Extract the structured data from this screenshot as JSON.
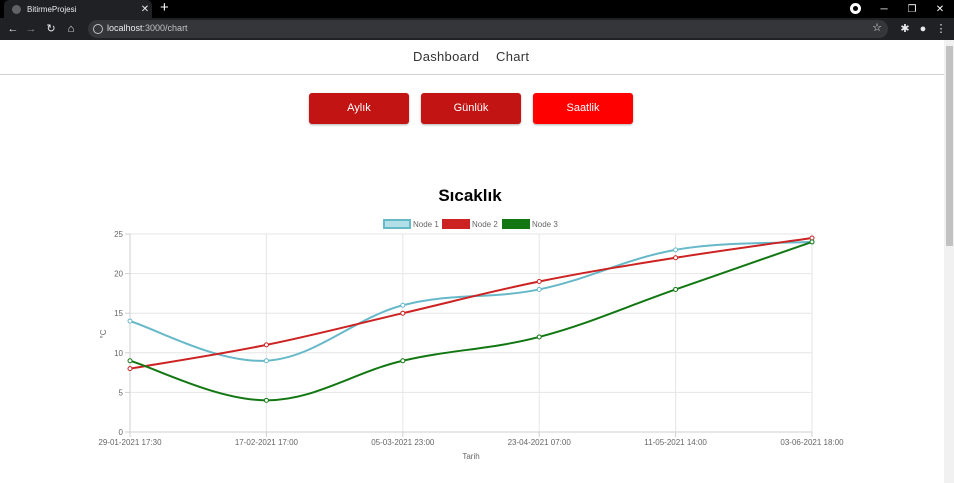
{
  "browser": {
    "tab_title": "BitirmeProjesi",
    "tab_close": "✕",
    "new_tab": "+",
    "url_host": "localhost",
    "url_rest": ":3000/chart",
    "minimize": "─",
    "restore": "❐",
    "close": "✕"
  },
  "nav": {
    "dashboard": "Dashboard",
    "chart": "Chart"
  },
  "buttons": {
    "monthly": "Aylık",
    "daily": "Günlük",
    "hourly": "Saatlik"
  },
  "colors": {
    "btn_monthly": "#c21413",
    "btn_daily": "#c21413",
    "btn_hourly": "#ff0000",
    "node1": "#67b8c9",
    "node2": "#cc2222",
    "node3": "#127712"
  },
  "chart_data": {
    "type": "line",
    "title": "Sıcaklık",
    "xlabel": "Tarih",
    "ylabel": "°C",
    "ylim": [
      0,
      25
    ],
    "yticks": [
      0,
      5,
      10,
      15,
      20,
      25
    ],
    "grid": true,
    "legend_position": "top",
    "categories": [
      "29-01-2021 17:30",
      "17-02-2021 17:00",
      "05-03-2021 23:00",
      "23-04-2021 07:00",
      "11-05-2021 14:00",
      "03-06-2021 18:00"
    ],
    "series": [
      {
        "name": "Node 1",
        "values": [
          14,
          9,
          16,
          18,
          23,
          24
        ]
      },
      {
        "name": "Node 2",
        "values": [
          8,
          11,
          15,
          19,
          22,
          24.5
        ]
      },
      {
        "name": "Node 3",
        "values": [
          9,
          4,
          9,
          12,
          18,
          24
        ]
      }
    ]
  }
}
